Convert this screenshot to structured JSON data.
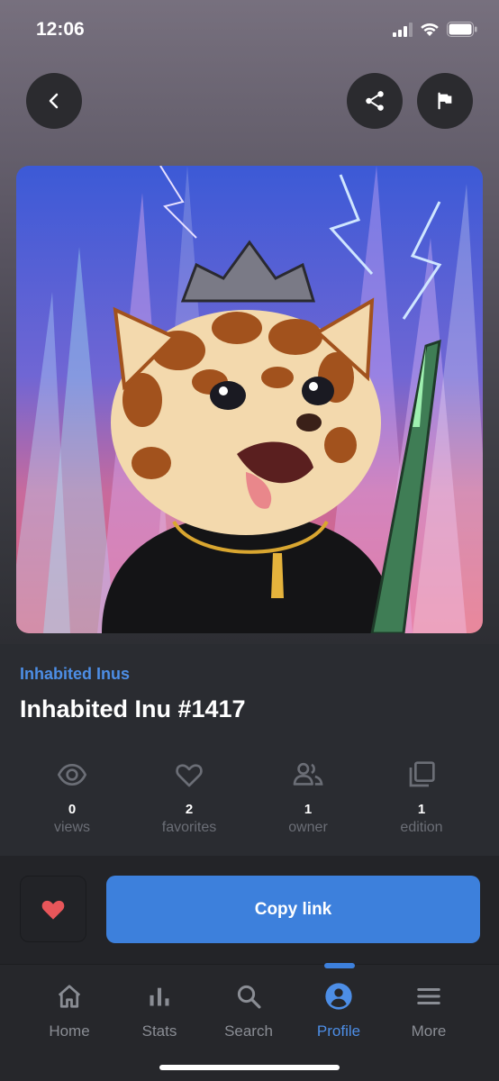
{
  "status_bar": {
    "time": "12:06"
  },
  "nft": {
    "collection": "Inhabited Inus",
    "title": "Inhabited Inu #1417",
    "image_alt": "Inhabited Inu artwork"
  },
  "stats": [
    {
      "icon": "eye-icon",
      "value": "0",
      "label": "views"
    },
    {
      "icon": "heart-outline-icon",
      "value": "2",
      "label": "favorites"
    },
    {
      "icon": "people-icon",
      "value": "1",
      "label": "owner"
    },
    {
      "icon": "copies-icon",
      "value": "1",
      "label": "edition"
    }
  ],
  "actions": {
    "copy_link": "Copy link"
  },
  "tabs": [
    {
      "icon": "home-icon",
      "label": "Home",
      "active": false
    },
    {
      "icon": "stats-icon",
      "label": "Stats",
      "active": false
    },
    {
      "icon": "search-icon",
      "label": "Search",
      "active": false
    },
    {
      "icon": "profile-icon",
      "label": "Profile",
      "active": true
    },
    {
      "icon": "menu-icon",
      "label": "More",
      "active": false
    }
  ],
  "colors": {
    "accent": "#3d80dc",
    "accent_text": "#4d8ee6",
    "like": "#e8565a",
    "background": "#2a2c31"
  }
}
